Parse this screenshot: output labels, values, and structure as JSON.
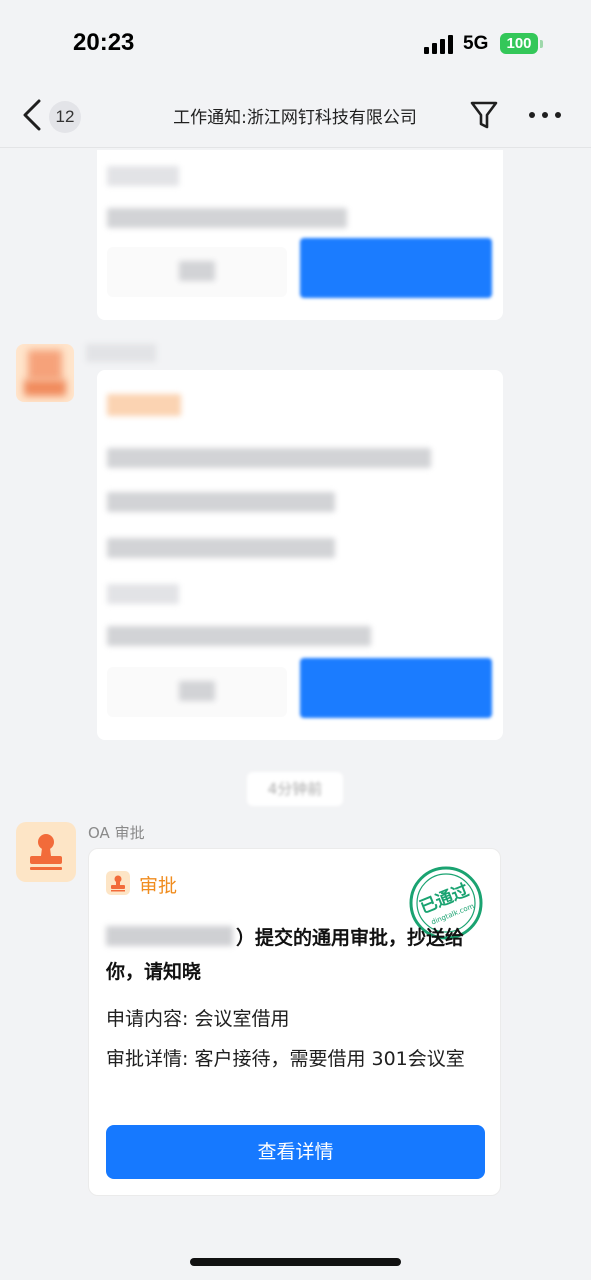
{
  "status_bar": {
    "time": "20:23",
    "network": "5G",
    "battery": "100"
  },
  "navbar": {
    "unread_count": "12",
    "title": "工作通知:浙江网钉科技有限公司"
  },
  "time_divider": "4分钟前",
  "oa_message": {
    "sender": "OA 审批",
    "app_label": "审批",
    "stamp_text": "已通过",
    "stamp_domain": "dingtalk.com",
    "title_suffix": "）提交的通用审批，抄送给你，请知晓",
    "content_line": "申请内容: 会议室借用",
    "detail_line": "审批详情: 客户接待，需要借用 301会议室",
    "button_label": "查看详情"
  },
  "colors": {
    "primary": "#1679ff",
    "orange": "#f08c1e",
    "stamp_green": "#1aa371",
    "battery_green": "#34c759"
  }
}
